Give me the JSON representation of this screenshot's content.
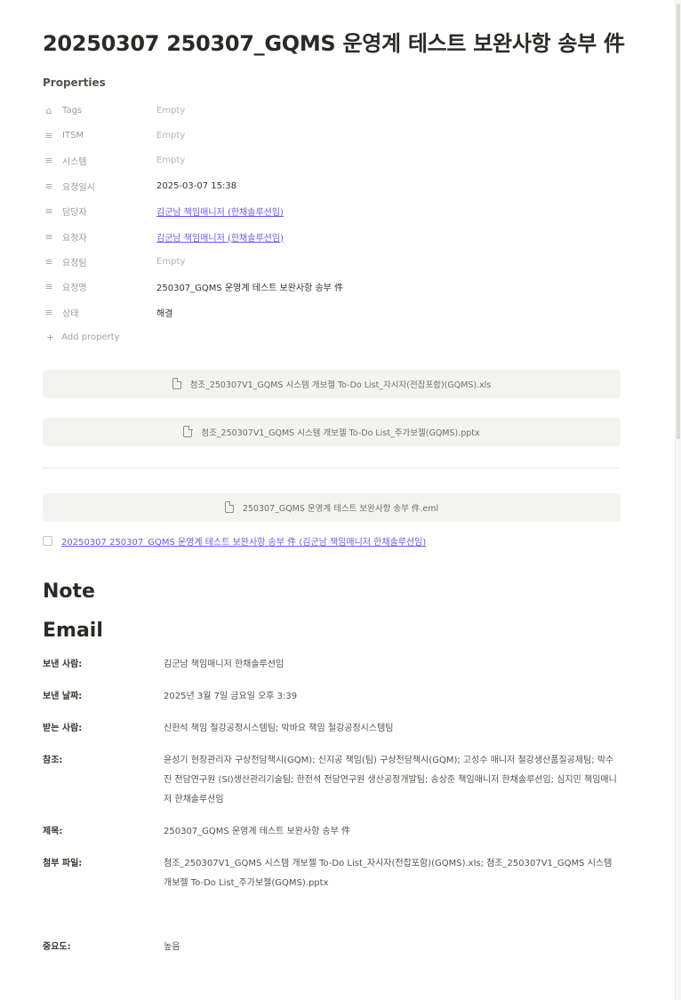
{
  "page": {
    "title": "20250307 250307_GQMS 운영계 테스트 보완사항 송부 件"
  },
  "properties": {
    "heading": "Properties",
    "items": [
      {
        "icon": "tag-icon",
        "glyph": "⌂",
        "name": "Tags",
        "value": "Empty",
        "kind": "empty"
      },
      {
        "icon": "list-icon",
        "glyph": "≡",
        "name": "ITSM",
        "value": "Empty",
        "kind": "empty"
      },
      {
        "icon": "list-icon",
        "glyph": "≡",
        "name": "시스템",
        "value": "Empty",
        "kind": "empty"
      },
      {
        "icon": "list-icon",
        "glyph": "≡",
        "name": "요청일시",
        "value": "2025-03-07 15:38",
        "kind": "text"
      },
      {
        "icon": "list-icon",
        "glyph": "≡",
        "name": "담당자",
        "value": "김군남 책임매니저 (한채솔루션임)",
        "kind": "person"
      },
      {
        "icon": "list-icon",
        "glyph": "≡",
        "name": "요청자",
        "value": "김군남 책임매니저 (한채솔루션임)",
        "kind": "person"
      },
      {
        "icon": "list-icon",
        "glyph": "≡",
        "name": "요청팀",
        "value": "Empty",
        "kind": "empty"
      },
      {
        "icon": "list-icon",
        "glyph": "≡",
        "name": "요청명",
        "value": "250307_GQMS 운영계 테스트 보완사항 송부 件",
        "kind": "text"
      },
      {
        "icon": "list-icon",
        "glyph": "≡",
        "name": "상태",
        "value": "해결",
        "kind": "text"
      }
    ],
    "add_label": "Add property"
  },
  "attachments": [
    {
      "name": "첨조_250307V1_GQMS 시스템 개보젤 To-Do List_자시자(전잡포함)(GQMS).xls"
    },
    {
      "name": "첨조_250307V1_GQMS 시스템 개보젤 To-Do List_주가보젤(GQMS).pptx"
    }
  ],
  "mail_file": {
    "name": "250307_GQMS 운영계 테스트 보완사항 송부 件.eml"
  },
  "mail_link": {
    "text": "20250307 250307_GQMS 운영계 테스트 보완사항 송부 件",
    "sender": "(김군남 책임매니저 한채솔루션임)"
  },
  "sections": {
    "note": "Note",
    "email": "Email"
  },
  "email_fields": [
    {
      "key": "보낸 사람:",
      "value": "김군남 책임매니저 한채솔루션임"
    },
    {
      "key": "보낸 날짜:",
      "value": "2025년 3월 7일 금요일 오후 3:39"
    },
    {
      "key": "받는 사람:",
      "value": "신헌석 책임 철강공정시스템팀; 박바요 책임 철강공정시스템팀"
    },
    {
      "key": "참조:",
      "value": "윤성기 현장관리자 구상전담책시(GQM); 신지공 책임(팀) 구상전담책시(GQM); 고성수 매니저 철강생산품질공제팀; 박수진 전담연구원 (SI)생산관리기술팀; 한전석 전담연구원 생산공정개발팀; 송상준 책임매니저 한채솔루션임; 심지민 책임매니저 한채솔루션임"
    },
    {
      "key": "제목:",
      "value": "250307_GQMS 운영계 테스트 보완사항 송부 件"
    },
    {
      "key": "첨부 파일:",
      "value": "첨조_250307V1_GQMS 시스템 개보젤 To-Do List_자시자(전잡포함)(GQMS).xls; 첨조_250307V1_GQMS 시스템 개보젤 To-Do List_주가보젤(GQMS).pptx"
    },
    {
      "key": "중요도:",
      "value": "높음"
    }
  ]
}
